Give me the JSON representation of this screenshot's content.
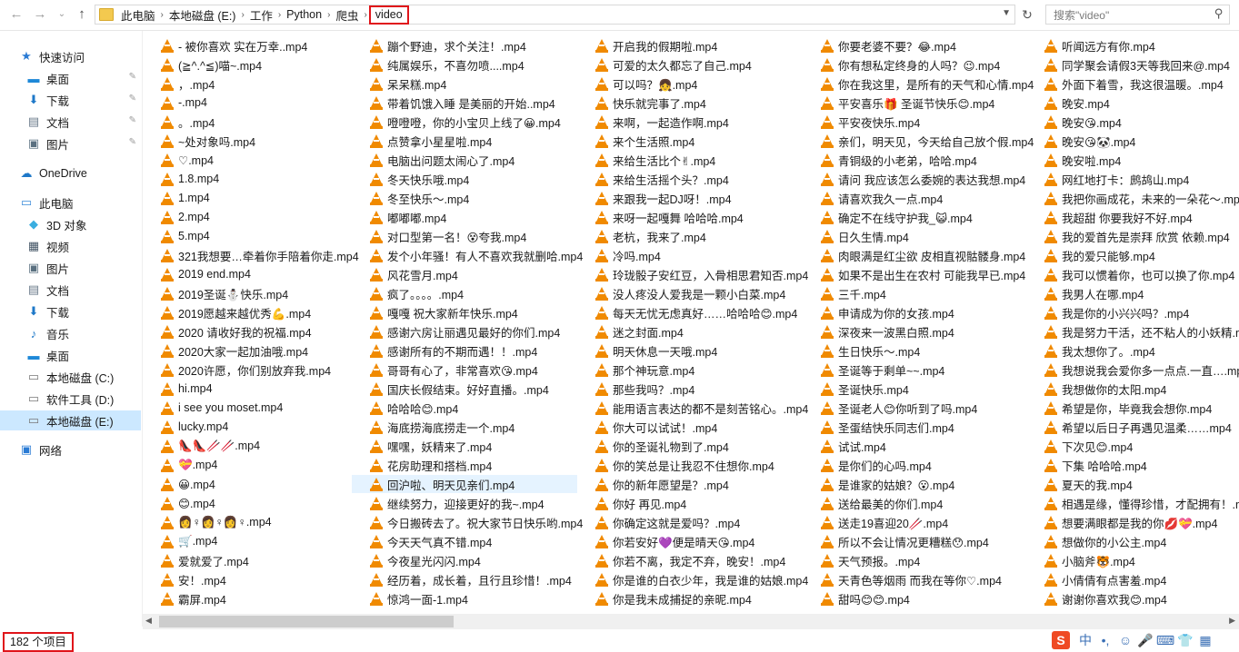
{
  "address": {
    "breadcrumbs": [
      "此电脑",
      "本地磁盘 (E:)",
      "工作",
      "Python",
      "爬虫"
    ],
    "current": "video"
  },
  "search": {
    "placeholder": "搜索\"video\""
  },
  "nav": {
    "items": [
      {
        "label": "快速访问",
        "icon": "star-icon",
        "level": 0
      },
      {
        "label": "桌面",
        "icon": "desktop-icon",
        "level": 1,
        "pinned": true
      },
      {
        "label": "下载",
        "icon": "download-icon",
        "level": 1,
        "pinned": true
      },
      {
        "label": "文档",
        "icon": "document-icon",
        "level": 1,
        "pinned": true
      },
      {
        "label": "图片",
        "icon": "pictures-icon",
        "level": 1,
        "pinned": true
      },
      {
        "label": "OneDrive",
        "icon": "cloud-icon",
        "level": 0
      },
      {
        "label": "此电脑",
        "icon": "computer-icon",
        "level": 0
      },
      {
        "label": "3D 对象",
        "icon": "3d-objects-icon",
        "level": 1
      },
      {
        "label": "视频",
        "icon": "video-icon",
        "level": 1
      },
      {
        "label": "图片",
        "icon": "pictures-icon",
        "level": 1
      },
      {
        "label": "文档",
        "icon": "document-icon",
        "level": 1
      },
      {
        "label": "下载",
        "icon": "download-icon",
        "level": 1
      },
      {
        "label": "音乐",
        "icon": "music-icon",
        "level": 1
      },
      {
        "label": "桌面",
        "icon": "desktop-icon",
        "level": 1
      },
      {
        "label": "本地磁盘 (C:)",
        "icon": "drive-icon",
        "level": 1
      },
      {
        "label": "软件工具 (D:)",
        "icon": "drive-icon",
        "level": 1
      },
      {
        "label": "本地磁盘 (E:)",
        "icon": "drive-icon",
        "level": 1,
        "selected": true
      },
      {
        "label": "网络",
        "icon": "network-icon",
        "level": 0
      }
    ]
  },
  "files": {
    "icon": "vlc-cone-icon",
    "highlighted": "回沪啦、明天见亲们.mp4",
    "columns": [
      [
        "- 被你喜欢 实在万幸..mp4",
        "(≧^.^≦)喵~.mp4",
        "，.mp4",
        "-.mp4",
        "。.mp4",
        "~处对象吗.mp4",
        "♡.mp4",
        "1.8.mp4",
        "1.mp4",
        "2.mp4",
        "5.mp4",
        "321我想要…牵着你手陪着你走.mp4",
        "2019  end.mp4",
        "2019圣诞⛄快乐.mp4",
        "2019愿越来越优秀💪.mp4",
        "2020 请收好我的祝福.mp4",
        "2020大家一起加油哦.mp4",
        "2020许愿，你们别放弃我.mp4",
        "hi.mp4",
        "i see you moset.mp4",
        "lucky.mp4",
        "👠👠🥢🥢.mp4",
        "💝.mp4",
        "😀.mp4",
        "😊.mp4",
        "👩♀👩♀👩♀.mp4",
        "🛒.mp4",
        "爱就爱了.mp4",
        "安！.mp4",
        "霸屏.mp4"
      ],
      [
        "蹦个野迪，求个关注！.mp4",
        "纯属娱乐，不喜勿喷....mp4",
        "呆呆糕.mp4",
        "带着饥饿入睡  是美丽的开始..mp4",
        "噔噔噔，你的小宝贝上线了😀.mp4",
        "点赞拿小星星啦.mp4",
        "电脑出问题太闹心了.mp4",
        "冬天快乐哦.mp4",
        "冬至快乐～.mp4",
        "嘟嘟嘟.mp4",
        "对口型第一名！😵夸我.mp4",
        "发个小年骚！有人不喜欢我就删哈.mp4",
        "风花雪月.mp4",
        "疯了。。。。.mp4",
        "嘎嘎 祝大家新年快乐.mp4",
        "感谢六房让丽遇见最好的你们.mp4",
        "感谢所有的不期而遇！！.mp4",
        "哥哥有心了，非常喜欢😘.mp4",
        "国庆长假结束。好好直播。.mp4",
        "哈哈哈😊.mp4",
        "海底捞海底捞走一个.mp4",
        "嘿嘿，妖精来了.mp4",
        "花房助理和搭档.mp4",
        "回沪啦、明天见亲们.mp4",
        "继续努力，迎接更好的我~.mp4",
        "今日搬砖去了。祝大家节日快乐哟.mp4",
        "今天天气真不错.mp4",
        "今夜星光闪闪.mp4",
        "经历着，成长着，且行且珍惜！.mp4",
        "惊鸿一面-1.mp4"
      ],
      [
        "开启我的假期啦.mp4",
        "可爱的太久都忘了自己.mp4",
        "可以吗？👧.mp4",
        "快乐就完事了.mp4",
        "来啊，一起造作啊.mp4",
        "来个生活照.mp4",
        "来给生活比个✌.mp4",
        "来给生活摇个头？.mp4",
        "来跟我一起DJ呀！.mp4",
        "来呀一起嘎舞 哈哈哈.mp4",
        "老杭，我来了.mp4",
        "冷吗.mp4",
        "玲珑骰子安红豆，入骨相思君知否.mp4",
        "没人疼没人爱我是一颗小白菜.mp4",
        "每天无忧无虑真好……哈哈哈😊.mp4",
        "迷之封面.mp4",
        "明天休息一天哦.mp4",
        "那个神玩意.mp4",
        "那些我吗？.mp4",
        "能用语言表达的都不是刻苦铭心。.mp4",
        "你大可以试试！.mp4",
        "你的圣诞礼物到了.mp4",
        "你的笑总是让我忍不住想你.mp4",
        "你的新年愿望是？.mp4",
        "你好 再见.mp4",
        "你确定这就是爱吗？.mp4",
        "你若安好💜便是晴天😘.mp4",
        "你若不离，我定不弃，晚安！.mp4",
        "你是谁的白衣少年，我是谁的姑娘.mp4",
        "你是我未成捕捉的亲昵.mp4"
      ],
      [
        "你要老婆不要？😂.mp4",
        "你有想私定终身的人吗？😉.mp4",
        "你在我这里，是所有的天气和心情.mp4",
        "平安喜乐🎁 圣诞节快乐😊.mp4",
        "平安夜快乐.mp4",
        "亲们，明天见，今天给自己放个假.mp4",
        "青铜级的小老弟，哈哈.mp4",
        "请问 我应该怎么委婉的表达我想.mp4",
        "请喜欢我久一点.mp4",
        "确定不在线守护我_😺.mp4",
        "日久生情.mp4",
        "肉眼满是红尘欲 皮相直视骷髅身.mp4",
        "如果不是出生在农村 可能我早已.mp4",
        "三千.mp4",
        "申请成为你的女孩.mp4",
        "深夜来一波黑白照.mp4",
        "生日快乐～.mp4",
        "圣诞等于剩单~~.mp4",
        "圣诞快乐.mp4",
        "圣诞老人😊你听到了吗.mp4",
        "圣蛋结快乐同志们.mp4",
        "试试.mp4",
        "是你们的心吗.mp4",
        "是谁家的姑娘？😮.mp4",
        "送给最美的你们.mp4",
        "送走19喜迎20🥢.mp4",
        "所以不会让情况更糟糕😯.mp4",
        "天气预报。.mp4",
        "天青色等烟雨 而我在等你♡.mp4",
        "甜吗😊😊.mp4"
      ],
      [
        "听闻远方有你.mp4",
        "同学聚会请假3天等我回来@.mp4",
        "外面下着雪，我这很温暖。.mp4",
        "晚安.mp4",
        "晚安😘.mp4",
        "晚安😘🐼.mp4",
        "晚安啦.mp4",
        "网红地打卡：鹧鸪山.mp4",
        "我把你画成花，未来的一朵花～.mp4",
        "我超甜 你要我好不好.mp4",
        "我的爱首先是崇拜 欣赏 依赖.mp4",
        "我的爱只能够.mp4",
        "我可以惯着你，也可以换了你.mp4",
        "我男人在哪.mp4",
        "我是你的小兴兴吗？.mp4",
        "我是努力干活，还不粘人的小妖精.mp4",
        "我太想你了。.mp4",
        "我想说我会爱你多一点点.一直….mp4",
        "我想做你的太阳.mp4",
        "希望是你，毕竟我会想你.mp4",
        "希望以后日子再遇见温柔……mp4",
        "下次见😊.mp4",
        "下集 哈哈哈.mp4",
        "夏天的我.mp4",
        "相遇是缘，懂得珍惜，才配拥有！.mp4",
        "想要满眼都是我的你💋💝.mp4",
        "想做你的小公主.mp4",
        "小脑斧🐯.mp4",
        "小倩倩有点害羞.mp4",
        "谢谢你喜欢我😊.mp4"
      ]
    ]
  },
  "status": {
    "count": "182 个项目"
  },
  "ime": {
    "logo": "S",
    "lang": "中",
    "punct": "•,"
  }
}
